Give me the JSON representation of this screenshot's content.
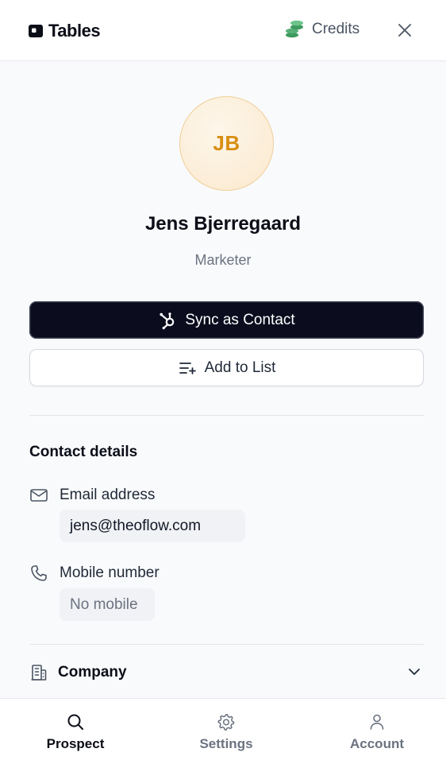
{
  "header": {
    "brand_name": "Tables",
    "credits_label": "Credits",
    "credits_icon": "coins-icon",
    "close_icon": "close-icon"
  },
  "profile": {
    "initials": "JB",
    "name": "Jens Bjerregaard",
    "role": "Marketer"
  },
  "actions": {
    "sync_label": "Sync as Contact",
    "add_to_list_label": "Add to List"
  },
  "contact_details": {
    "title": "Contact details",
    "email": {
      "label": "Email address",
      "value": "jens@theoflow.com"
    },
    "mobile": {
      "label": "Mobile number",
      "value": "No mobile"
    }
  },
  "company": {
    "label": "Company",
    "expanded": false
  },
  "nav": {
    "items": [
      {
        "label": "Prospect",
        "icon": "search-icon",
        "active": true
      },
      {
        "label": "Settings",
        "icon": "gear-icon",
        "active": false
      },
      {
        "label": "Account",
        "icon": "user-icon",
        "active": false
      }
    ]
  },
  "colors": {
    "primary_button": "#0b0c1e",
    "avatar_text": "#d98e12",
    "credits_icon": "#3f9a5f"
  }
}
